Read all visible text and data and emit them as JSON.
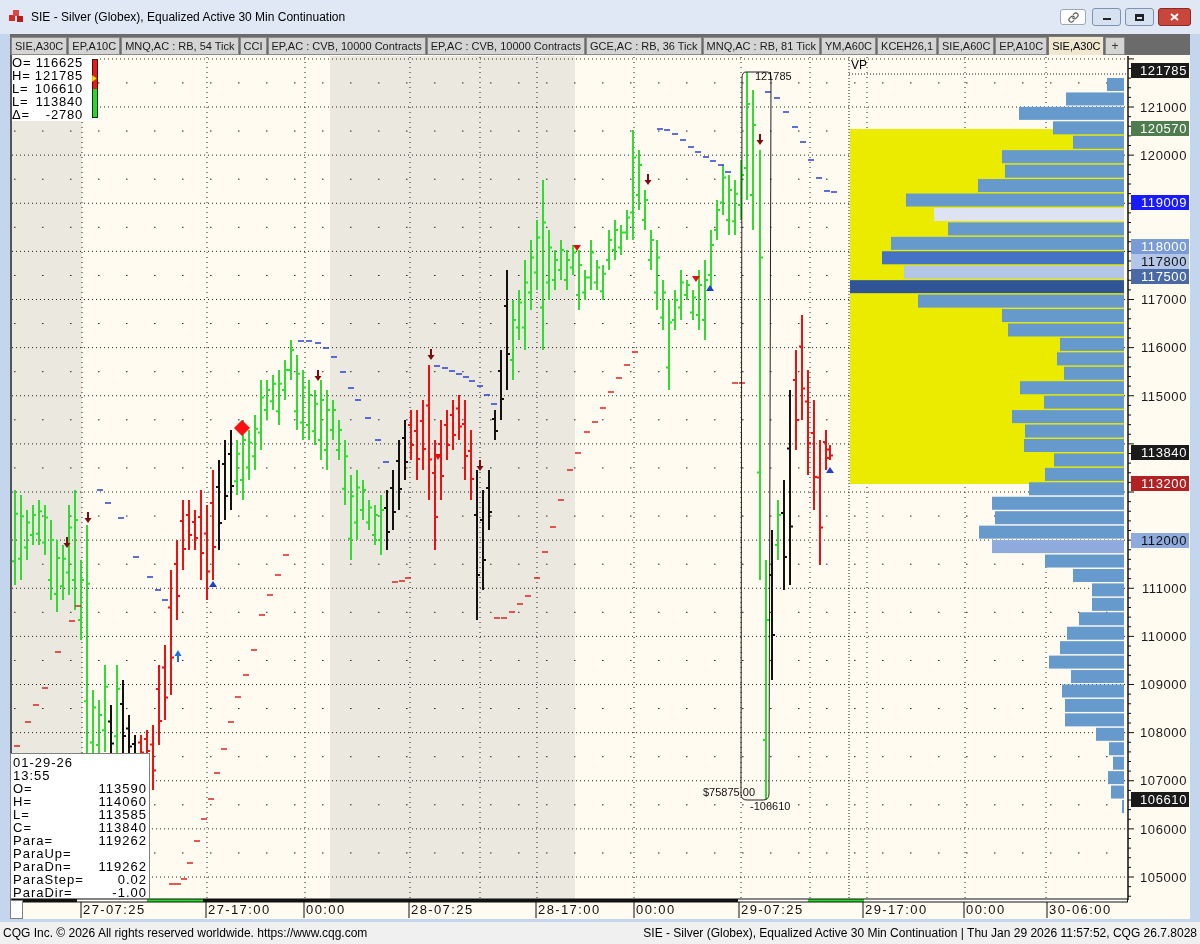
{
  "window": {
    "title": "SIE - Silver (Globex), Equalized Active 30 Min Continuation"
  },
  "tabs": [
    {
      "label": "SIE,A30C",
      "selected": false
    },
    {
      "label": "EP,A10C",
      "selected": false
    },
    {
      "label": "MNQ,AC : RB, 54 Tick",
      "selected": false
    },
    {
      "label": "CCI",
      "selected": false
    },
    {
      "label": "EP,AC : CVB, 10000 Contracts",
      "selected": false
    },
    {
      "label": "EP,AC : CVB, 10000 Contracts",
      "selected": false
    },
    {
      "label": "GCE,AC : RB, 36 Tick",
      "selected": false
    },
    {
      "label": "MNQ,AC : RB, 81 Tick",
      "selected": false
    },
    {
      "label": "YM,A60C",
      "selected": false
    },
    {
      "label": "KCEH26,1",
      "selected": false
    },
    {
      "label": "SIE,A60C",
      "selected": false
    },
    {
      "label": "EP,A10C",
      "selected": false
    },
    {
      "label": "SIE,A30C",
      "selected": true
    }
  ],
  "add_tab": "+",
  "summary": [
    {
      "label": "O=",
      "value": "116625"
    },
    {
      "label": "H=",
      "value": "121785"
    },
    {
      "label": "L=",
      "value": "106610"
    },
    {
      "label": "L=",
      "value": "113840"
    },
    {
      "label": "Δ=",
      "value": "-2780"
    }
  ],
  "range_meter": {
    "level": 0.49
  },
  "chart": {
    "profile_label": "VP",
    "annotations": [
      "121785",
      "$75875.00",
      "-106610"
    ]
  },
  "price_axis": [
    {
      "label": "121785",
      "kind": "marker",
      "color": "#1a1a1a"
    },
    {
      "label": "121000",
      "kind": "tick"
    },
    {
      "label": "120570",
      "kind": "marker",
      "color": "#4e7c4e"
    },
    {
      "label": "120000",
      "kind": "tick"
    },
    {
      "label": "119009",
      "kind": "marker",
      "color": "#1a1aff"
    },
    {
      "label": "118000",
      "kind": "marker",
      "color": "#7b9bd6"
    },
    {
      "label": "117800",
      "kind": "marker",
      "color": "#b4c6e7"
    },
    {
      "label": "117500",
      "kind": "marker",
      "color": "#4a6aa5"
    },
    {
      "label": "117000",
      "kind": "tick"
    },
    {
      "label": "116000",
      "kind": "tick"
    },
    {
      "label": "115000",
      "kind": "tick"
    },
    {
      "label": "113840",
      "kind": "marker",
      "color": "#1a1a1a"
    },
    {
      "label": "113200",
      "kind": "marker",
      "color": "#b22222"
    },
    {
      "label": "112000",
      "kind": "marker",
      "color": "#8faadc"
    },
    {
      "label": "111000",
      "kind": "tick"
    },
    {
      "label": "110000",
      "kind": "tick"
    },
    {
      "label": "109000",
      "kind": "tick"
    },
    {
      "label": "108000",
      "kind": "tick"
    },
    {
      "label": "107000",
      "kind": "tick"
    },
    {
      "label": "106610",
      "kind": "marker",
      "color": "#1a1a1a"
    },
    {
      "label": "106000",
      "kind": "tick"
    },
    {
      "label": "105000",
      "kind": "tick"
    }
  ],
  "time_axis": [
    "27-07:25",
    "27-17:00",
    "00:00",
    "28-07:25",
    "28-17:00",
    "00:00",
    "29-07:25",
    "29-17:00",
    "00:00",
    "30-06:00"
  ],
  "data_window": {
    "date": "01-29-26",
    "time": "13:55",
    "rows": [
      {
        "label": "O=",
        "value": "113590"
      },
      {
        "label": "H=",
        "value": "114060"
      },
      {
        "label": "L=",
        "value": "113585"
      },
      {
        "label": "C=",
        "value": "113840"
      },
      {
        "label": "Para=",
        "value": "119262"
      },
      {
        "label": "ParaUp="
      },
      {
        "label": "ParaDn=",
        "value": "119262"
      },
      {
        "label": "ParaStep=",
        "value": "0.02"
      },
      {
        "label": "ParaDir=",
        "value": "-1.00"
      }
    ]
  },
  "status_bar": {
    "left": "CQG Inc. © 2026 All rights reserved worldwide. https://www.cqg.com",
    "right": "SIE - Silver (Globex), Equalized Active 30 Min Continuation | Thu Jan 29 2026 11:57:52, CQG 26.7.8028"
  }
}
